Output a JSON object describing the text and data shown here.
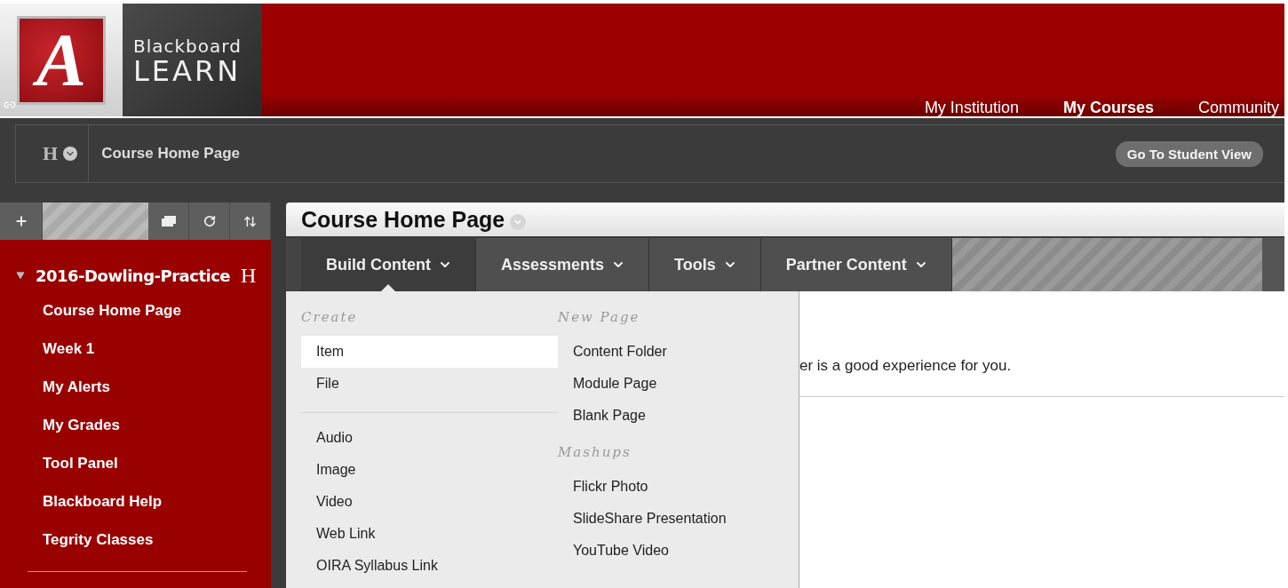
{
  "logo": {
    "emblem": "A",
    "brand": "Blackboard",
    "product": "LEARN"
  },
  "top_nav": [
    {
      "label": "My Institution",
      "selected": false
    },
    {
      "label": "My Courses",
      "selected": true
    },
    {
      "label": "Community",
      "selected": false
    }
  ],
  "breadcrumb": {
    "course_initial": "H",
    "current": "Course Home Page"
  },
  "student_view_button": "Go To Student View",
  "course_menu": {
    "title": "2016-Dowling-Practice",
    "initial": "H",
    "expanded": true,
    "items": [
      "Course Home Page",
      "Week 1",
      "My Alerts",
      "My Grades",
      "Tool Panel",
      "Blackboard Help",
      "Tegrity Classes"
    ]
  },
  "page": {
    "title": "Course Home Page",
    "menu_tabs": [
      {
        "label": "Build Content",
        "selected": true
      },
      {
        "label": "Assessments",
        "selected": false
      },
      {
        "label": "Tools",
        "selected": false
      },
      {
        "label": "Partner Content",
        "selected": false
      }
    ],
    "build_menu": {
      "left": {
        "heading": "Create",
        "groups": [
          [
            {
              "label": "Item",
              "selected": true
            },
            {
              "label": "File",
              "selected": false
            }
          ],
          [
            {
              "label": "Audio",
              "selected": false
            },
            {
              "label": "Image",
              "selected": false
            },
            {
              "label": "Video",
              "selected": false
            },
            {
              "label": "Web Link",
              "selected": false
            },
            {
              "label": "OIRA Syllabus Link",
              "selected": false
            }
          ]
        ]
      },
      "right": [
        {
          "heading": "New Page",
          "items": [
            {
              "label": "Content Folder",
              "selected": false
            },
            {
              "label": "Module Page",
              "selected": false
            },
            {
              "label": "Blank Page",
              "selected": false
            }
          ]
        },
        {
          "heading": "Mashups",
          "items": [
            {
              "label": "Flickr Photo",
              "selected": false
            },
            {
              "label": "SlideShare Presentation",
              "selected": false
            },
            {
              "label": "YouTube Video",
              "selected": false
            }
          ]
        }
      ]
    },
    "message": "er is a good experience for you."
  }
}
